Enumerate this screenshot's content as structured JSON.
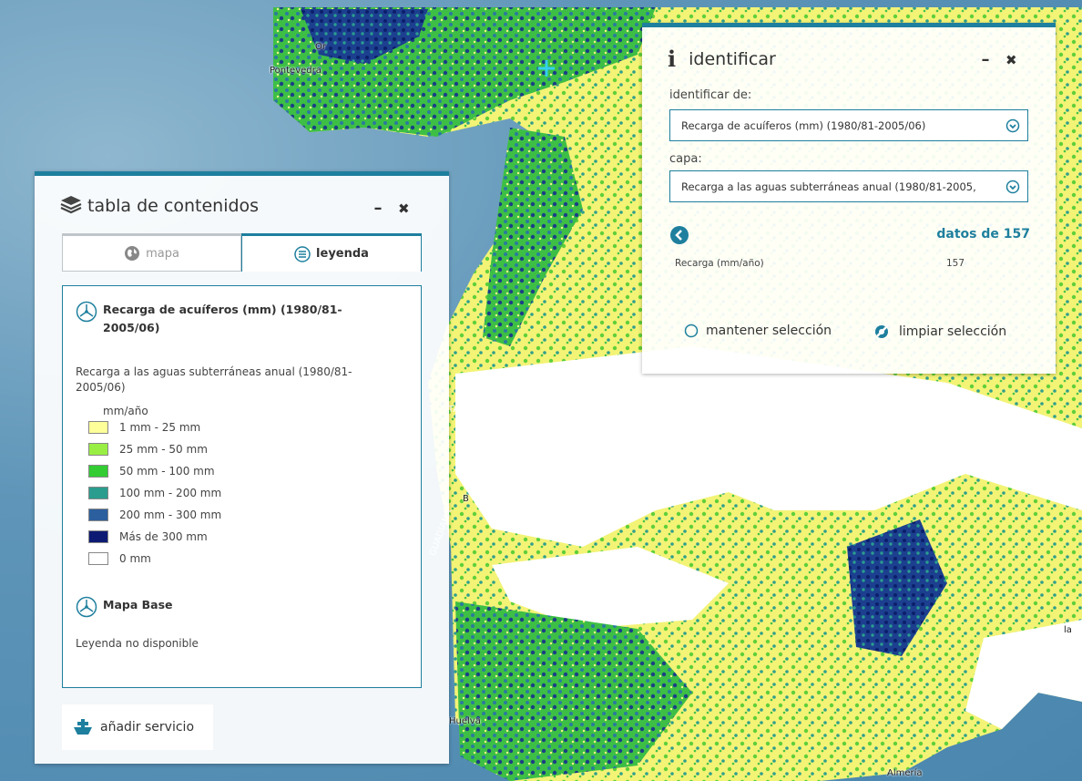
{
  "map": {
    "labels": [
      "Pontevedra",
      "Or",
      "TAJO",
      "GUADIANA",
      "B",
      "Huelva",
      "Almería",
      "la"
    ],
    "colors": {
      "sea": "#5a93b8",
      "no_data": "#ffffff",
      "yellow": "#fafa80",
      "green": "#33cc33",
      "teal": "#2a9d8f",
      "navy": "#0b1f6b"
    }
  },
  "toc": {
    "title": "tabla de contenidos",
    "minimize": "–",
    "close": "✖",
    "tabs": {
      "map": "mapa",
      "legend": "leyenda"
    },
    "services": [
      {
        "name": "Recarga de acuíferos (mm) (1980/81-2005/06)"
      },
      {
        "name": "Mapa Base"
      }
    ],
    "layer_name": "Recarga a las aguas subterráneas anual (1980/81-2005/06)",
    "unit": "mm/año",
    "legend": [
      {
        "label": "1 mm - 25 mm",
        "color": "#ffff99"
      },
      {
        "label": "25 mm - 50 mm",
        "color": "#99ee44"
      },
      {
        "label": "50 mm - 100 mm",
        "color": "#33cc33"
      },
      {
        "label": "100 mm - 200 mm",
        "color": "#2a9d8f"
      },
      {
        "label": "200 mm - 300 mm",
        "color": "#2c5f9e"
      },
      {
        "label": "Más de 300 mm",
        "color": "#0d1a73"
      },
      {
        "label": "0 mm",
        "color": "#ffffff"
      }
    ],
    "no_legend": "Leyenda no disponible",
    "add_service": "añadir servicio"
  },
  "identify": {
    "title": "identificar",
    "info_glyph": "i",
    "minimize": "–",
    "close": "✖",
    "from_label": "identificar de:",
    "from_value": "Recarga de acuíferos (mm) (1980/81-2005/06)",
    "layer_label": "capa:",
    "layer_value": "Recarga a las aguas subterráneas anual (1980/81-2005,",
    "datos": "datos de 157",
    "result": {
      "field": "Recarga (mm/año)",
      "value": "157"
    },
    "keep_selection": "mantener selección",
    "clear_selection": "limpiar selección"
  },
  "accent": "#1e7f9e"
}
